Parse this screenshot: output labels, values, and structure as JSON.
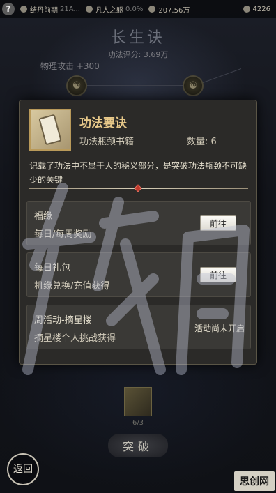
{
  "topbar": {
    "help_label": "?",
    "stat1_label": "结丹前期",
    "stat1_sub": "21A...",
    "stat2_label": "凡人之躯",
    "stat2_value": "0.0%",
    "stat3_value": "207.56万",
    "stat4_value": "4226"
  },
  "page": {
    "title": "长生诀",
    "score": "功法评分: 3.69万",
    "bonus": "物理攻击 +300"
  },
  "modal": {
    "item_name": "功法要诀",
    "item_type": "功法瓶颈书籍",
    "item_qty": "数量: 6",
    "item_desc": "记载了功法中不显于人的秘义部分，是突破功法瓶颈不可缺少的关键",
    "sources": [
      {
        "title": "福缘",
        "desc": "每日/每周奖励",
        "action": "前往"
      },
      {
        "title": "每日礼包",
        "desc": "机缘兑换/充值获得",
        "action": "前往"
      },
      {
        "title": "周活动-摘星楼",
        "desc": "摘星楼个人挑战获得",
        "status": "活动尚未开启"
      }
    ]
  },
  "bottom": {
    "progress": "6/3",
    "break_label": "突破",
    "back_label": "返回",
    "corner_text": "思创网"
  },
  "colors": {
    "accent_gold": "#e8c98a",
    "gem_red": "#c0392b"
  }
}
